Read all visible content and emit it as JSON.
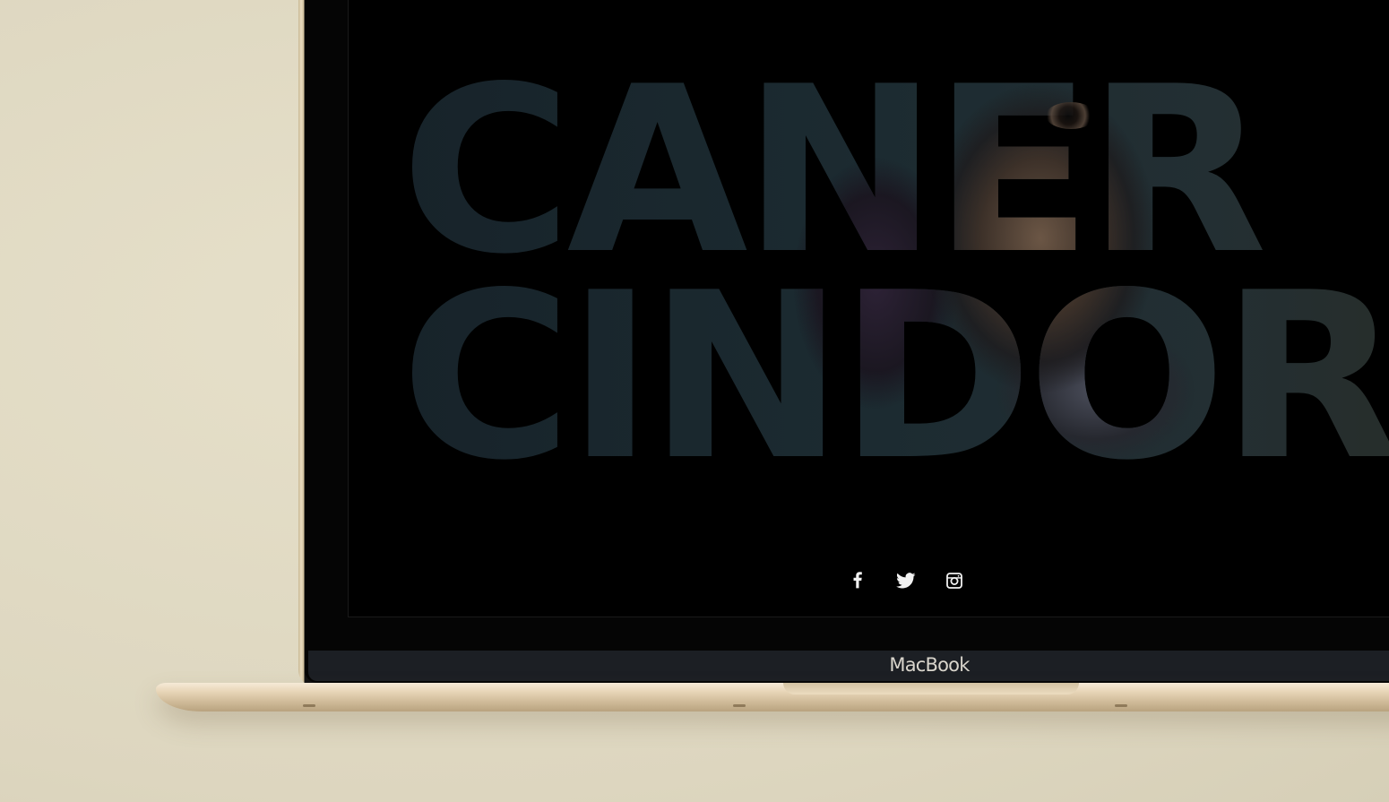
{
  "hero": {
    "name_line1": "CANER",
    "name_line2": "CINDORUK"
  },
  "social": [
    {
      "icon": "facebook-icon"
    },
    {
      "icon": "twitter-icon"
    },
    {
      "icon": "instagram-icon"
    }
  ],
  "device": {
    "brand_label": "MacBook"
  },
  "colors": {
    "background": "#e3dcc6",
    "screen": "#000000",
    "icon": "#f2f2f2",
    "laptop_gold": "#e8d6b8"
  }
}
